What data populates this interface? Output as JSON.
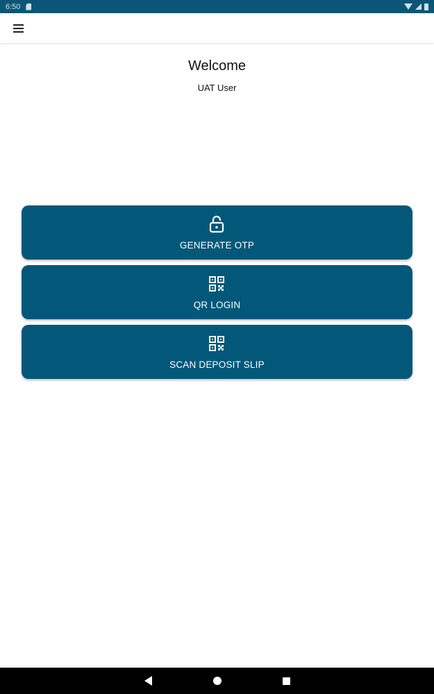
{
  "status_bar": {
    "time": "6:50",
    "icons": [
      "sd-card-icon",
      "wifi-icon",
      "signal-icon",
      "battery-icon"
    ]
  },
  "app_bar": {
    "menu_icon": "hamburger-menu-icon"
  },
  "header": {
    "title": "Welcome",
    "user": "UAT User"
  },
  "actions": [
    {
      "label": "GENERATE OTP",
      "icon": "unlock-icon"
    },
    {
      "label": "QR LOGIN",
      "icon": "qr-code-icon"
    },
    {
      "label": "SCAN DEPOSIT SLIP",
      "icon": "qr-code-icon"
    }
  ],
  "nav_bar": {
    "icons": [
      "back-icon",
      "home-icon",
      "recents-icon"
    ]
  },
  "colors": {
    "primary": "#03587a",
    "status_bar": "#0b5677",
    "background": "#ffffff",
    "nav_bar": "#000000"
  }
}
